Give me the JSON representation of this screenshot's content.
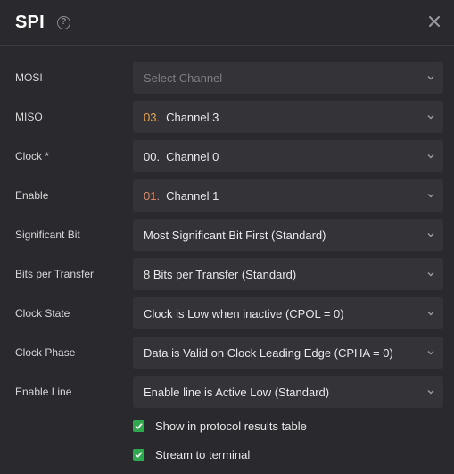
{
  "dialog": {
    "title": "SPI",
    "help_glyph": "?",
    "help_icon": "help-circle-icon",
    "close_icon": "close-icon"
  },
  "fields": [
    {
      "label": "MOSI",
      "num": "",
      "value": "Select Channel",
      "placeholder": true,
      "num_color": ""
    },
    {
      "label": "MISO",
      "num": "03.",
      "value": "Channel 3",
      "placeholder": false,
      "num_color": "#e8a34a"
    },
    {
      "label": "Clock *",
      "num": "00.",
      "value": "Channel 0",
      "placeholder": false,
      "num_color": "#e8e8ea"
    },
    {
      "label": "Enable",
      "num": "01.",
      "value": "Channel 1",
      "placeholder": false,
      "num_color": "#d98a6a"
    },
    {
      "label": "Significant Bit",
      "num": "",
      "value": "Most Significant Bit First (Standard)",
      "placeholder": false,
      "num_color": ""
    },
    {
      "label": "Bits per Transfer",
      "num": "",
      "value": "8 Bits per Transfer (Standard)",
      "placeholder": false,
      "num_color": ""
    },
    {
      "label": "Clock State",
      "num": "",
      "value": "Clock is Low when inactive (CPOL = 0)",
      "placeholder": false,
      "num_color": ""
    },
    {
      "label": "Clock Phase",
      "num": "",
      "value": "Data is Valid on Clock Leading Edge (CPHA = 0)",
      "placeholder": false,
      "num_color": ""
    },
    {
      "label": "Enable Line",
      "num": "",
      "value": "Enable line is Active Low (Standard)",
      "placeholder": false,
      "num_color": ""
    }
  ],
  "options": [
    {
      "label": "Show in protocol results table",
      "checked": true
    },
    {
      "label": "Stream to terminal",
      "checked": true
    }
  ],
  "colors": {
    "background": "#2a2a2e",
    "select_bg": "#333338",
    "checkbox": "#2fa84f"
  }
}
